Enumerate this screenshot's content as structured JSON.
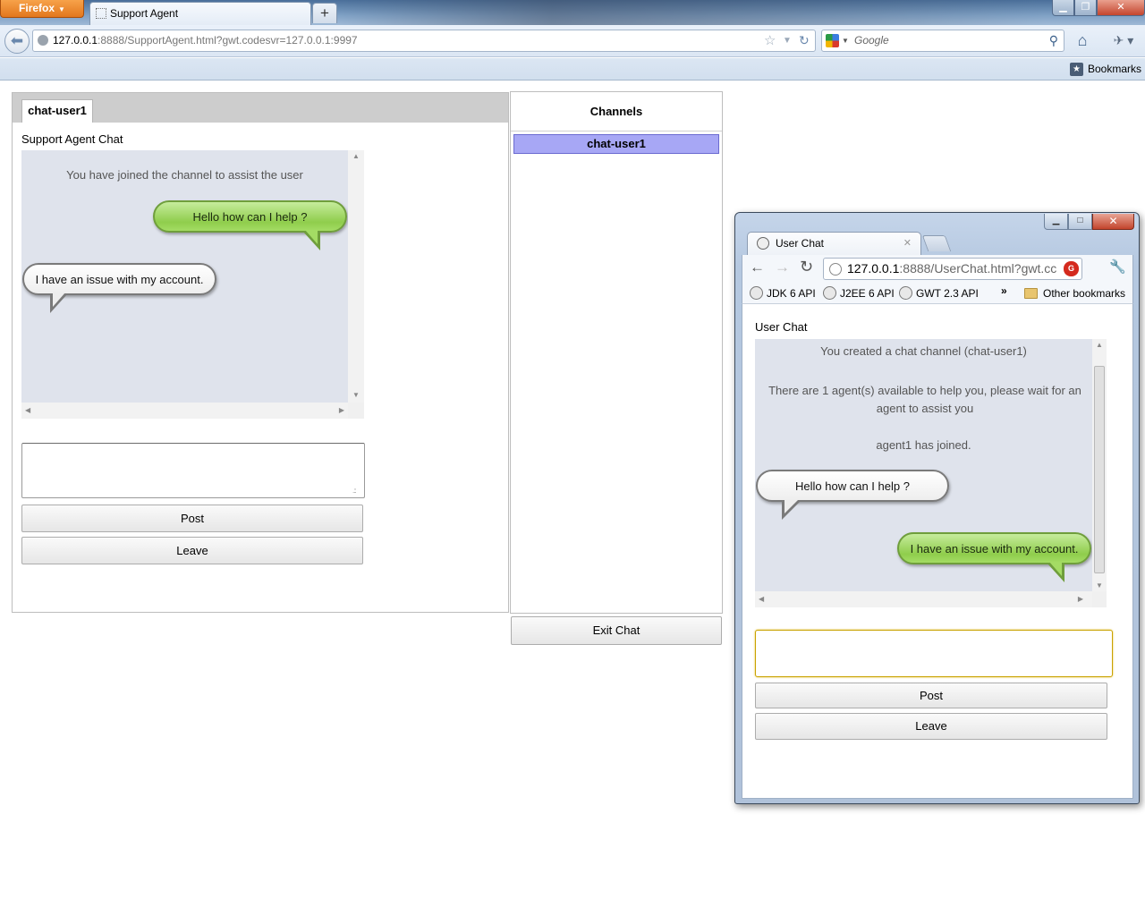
{
  "firefox": {
    "menu_button": "Firefox",
    "tab_title": "Support Agent",
    "url_host": "127.0.0.1",
    "url_rest": ":8888/SupportAgent.html?gwt.codesvr=127.0.0.1:9997",
    "search_placeholder": "Google",
    "bookmarks_label": "Bookmarks"
  },
  "agent": {
    "tab_label": "chat-user1",
    "title": "Support Agent Chat",
    "messages": [
      {
        "kind": "system",
        "text": "You have joined the channel to assist the user"
      },
      {
        "kind": "sent",
        "text": "Hello how can I help ?"
      },
      {
        "kind": "received",
        "text": "I have an issue with my account."
      }
    ],
    "message_input_value": "",
    "post_label": "Post",
    "leave_label": "Leave"
  },
  "channels": {
    "header": "Channels",
    "items": [
      "chat-user1"
    ],
    "exit_label": "Exit Chat"
  },
  "chrome": {
    "tab_title": "User Chat",
    "url_host": "127.0.0.1",
    "url_rest": ":8888/UserChat.html?gwt.cc",
    "extension_badge": "G",
    "bookmarks": [
      "JDK 6 API",
      "J2EE 6 API",
      "GWT 2.3 API"
    ],
    "bookmarks_overflow": "»",
    "other_bookmarks": "Other bookmarks"
  },
  "user": {
    "title": "User Chat",
    "messages": [
      {
        "kind": "system",
        "text": "You created a chat channel (chat-user1)"
      },
      {
        "kind": "system",
        "text": "There are 1 agent(s) available to help you, please wait for an agent to assist you"
      },
      {
        "kind": "system",
        "text": "agent1 has joined."
      },
      {
        "kind": "received",
        "text": "Hello how can I help ?"
      },
      {
        "kind": "sent",
        "text": "I have an issue with my account."
      }
    ],
    "message_input_value": "",
    "post_label": "Post",
    "leave_label": "Leave"
  },
  "colors": {
    "channel_selected": "#a7a7f5",
    "chat_area_bg": "#dfe3ec",
    "bubble_green": "#8fcd4c",
    "bubble_white": "#ffffff"
  }
}
